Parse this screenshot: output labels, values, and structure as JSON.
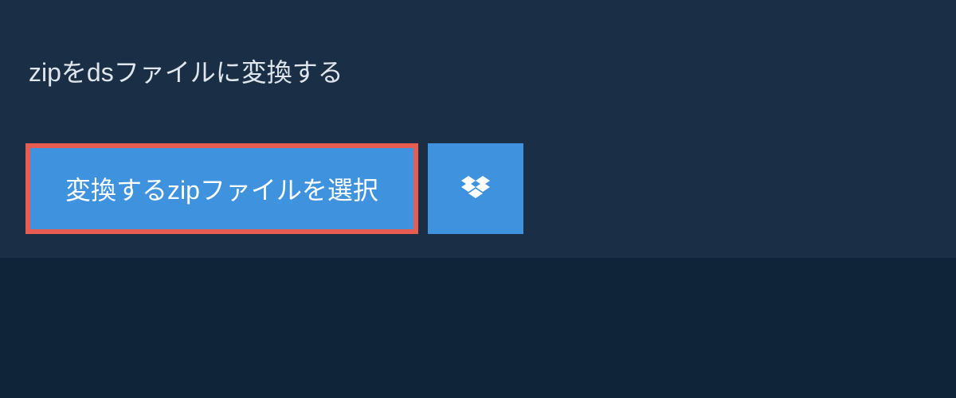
{
  "title": "zipをdsファイルに変換する",
  "selectButton": {
    "label": "変換するzipファイルを選択"
  },
  "icons": {
    "dropbox": "dropbox-icon"
  }
}
